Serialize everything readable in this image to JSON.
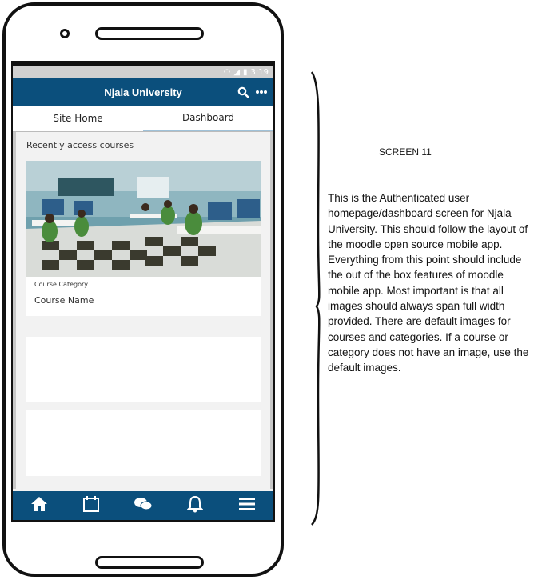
{
  "status_bar": {
    "time": "3:19"
  },
  "app_bar": {
    "title": "Njala University",
    "search_icon": "search-icon",
    "more_icon": "more-icon"
  },
  "tabs": [
    {
      "label": "Site Home",
      "active": false
    },
    {
      "label": "Dashboard",
      "active": true
    }
  ],
  "recent": {
    "title": "Recently access courses",
    "courses": [
      {
        "category": "Course Category",
        "name": "Course Name"
      }
    ]
  },
  "bottom_nav": [
    "home-icon",
    "calendar-icon",
    "chat-icon",
    "bell-icon",
    "menu-icon"
  ],
  "annotation": {
    "label": "SCREEN 11",
    "text": "This is the Authenticated user homepage/dashboard screen for Njala University. This should follow the layout of the moodle open source mobile app. Everything from this point should include the out of the box features of moodle mobile app. Most important is that all images should always span full width provided. There are default images for courses and categories. If a course or category does not have an image, use the default images."
  },
  "colors": {
    "brand": "#0b4f7c",
    "tab_indicator": "#9fc1d8"
  }
}
